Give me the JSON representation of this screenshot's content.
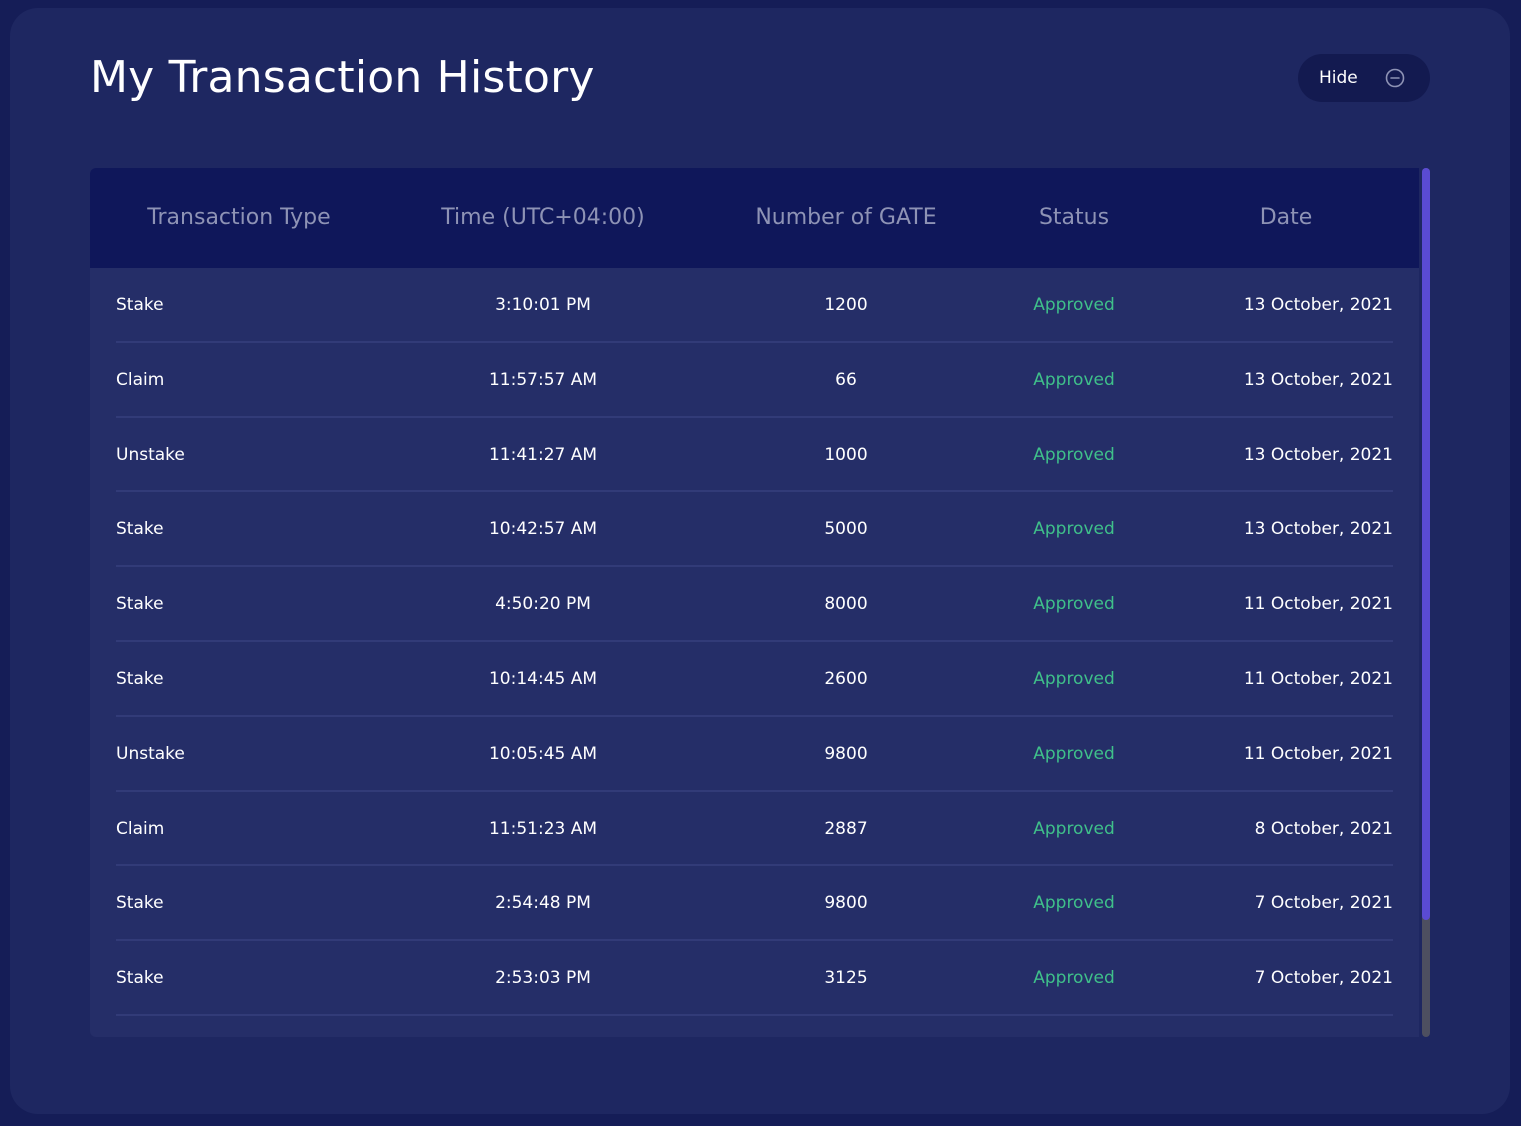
{
  "page": {
    "title": "My Transaction History",
    "hide_button_label": "Hide",
    "hide_button_icon": "minus-circle-icon"
  },
  "table": {
    "columns": [
      "Transaction Type",
      "Time (UTC+04:00)",
      "Number of GATE",
      "Status",
      "Date"
    ],
    "rows": [
      {
        "type": "Stake",
        "time": "3:10:01 PM",
        "amount": "1200",
        "status": "Approved",
        "date": "13 October, 2021"
      },
      {
        "type": "Claim",
        "time": "11:57:57 AM",
        "amount": "66",
        "status": "Approved",
        "date": "13 October, 2021"
      },
      {
        "type": "Unstake",
        "time": "11:41:27 AM",
        "amount": "1000",
        "status": "Approved",
        "date": "13 October, 2021"
      },
      {
        "type": "Stake",
        "time": "10:42:57 AM",
        "amount": "5000",
        "status": "Approved",
        "date": "13 October, 2021"
      },
      {
        "type": "Stake",
        "time": "4:50:20 PM",
        "amount": "8000",
        "status": "Approved",
        "date": "11 October, 2021"
      },
      {
        "type": "Stake",
        "time": "10:14:45 AM",
        "amount": "2600",
        "status": "Approved",
        "date": "11 October, 2021"
      },
      {
        "type": "Unstake",
        "time": "10:05:45 AM",
        "amount": "9800",
        "status": "Approved",
        "date": "11 October, 2021"
      },
      {
        "type": "Claim",
        "time": "11:51:23 AM",
        "amount": "2887",
        "status": "Approved",
        "date": "8 October, 2021"
      },
      {
        "type": "Stake",
        "time": "2:54:48 PM",
        "amount": "9800",
        "status": "Approved",
        "date": "7 October, 2021"
      },
      {
        "type": "Stake",
        "time": "2:53:03 PM",
        "amount": "3125",
        "status": "Approved",
        "date": "7 October, 2021"
      }
    ]
  },
  "colors": {
    "page_background": "#151d57",
    "panel_background": "#1e2761",
    "header_background": "#0f175a",
    "status_approved": "#3fc08a",
    "scroll_thumb": "#5a4bd3"
  }
}
